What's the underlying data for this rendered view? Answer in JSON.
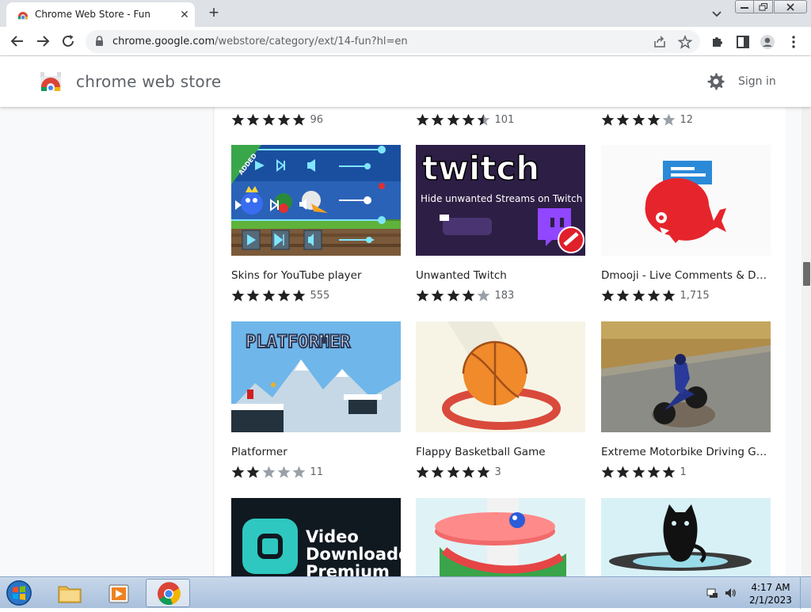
{
  "browser": {
    "tab_title": "Chrome Web Store - Fun",
    "url_host": "chrome.google.com",
    "url_path": "/webstore/category/ext/14-fun?hl=en"
  },
  "store": {
    "title": "chrome web store",
    "sign_in": "Sign in"
  },
  "top_row_counts": [
    "96",
    "101",
    "12"
  ],
  "top_row_ratings": [
    5,
    4.5,
    4
  ],
  "cards": [
    {
      "name": "Skins for YouTube player",
      "rating": 5,
      "count": "555"
    },
    {
      "name": "Unwanted Twitch",
      "rating": 4,
      "count": "183"
    },
    {
      "name": "Dmooji - Live Comments & Danmaku",
      "rating": 5,
      "count": "1,715"
    },
    {
      "name": "Platformer",
      "rating": 2,
      "count": "11"
    },
    {
      "name": "Flappy Basketball Game",
      "rating": 5,
      "count": "3"
    },
    {
      "name": "Extreme Motorbike Driving Game",
      "rating": 5,
      "count": "1"
    }
  ],
  "thumb_text": {
    "added": "ADDED",
    "twitch_logo": "twitch",
    "twitch_caption": "Hide unwanted Streams on Twitch",
    "platformer_logo": "PLATFORMER",
    "video_line1": "Video",
    "video_line2": "Downloader",
    "video_line3": "Premium"
  },
  "taskbar": {
    "time": "4:17 AM",
    "date": "2/1/2023"
  },
  "colors": {
    "star_filled": "#202124",
    "star_empty": "#9aa0a6",
    "twitch_bg": "#2d1e45",
    "dmooji_red": "#e6242b",
    "dmooji_blue": "#2a8ad8"
  }
}
